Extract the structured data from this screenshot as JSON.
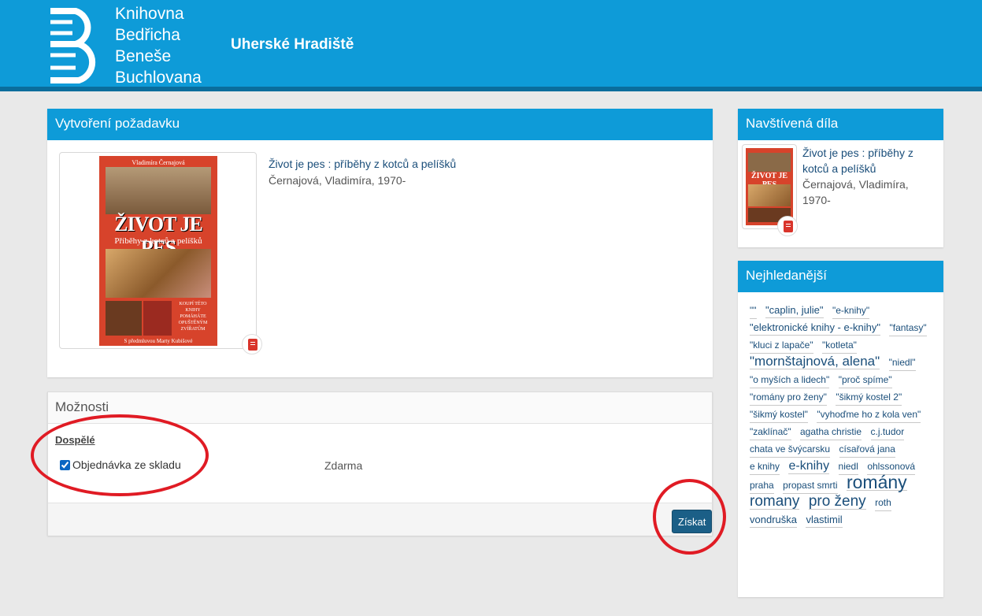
{
  "header": {
    "logo_lines": [
      "Knihovna",
      "Bedřicha",
      "Beneše",
      "Buchlovana"
    ],
    "city": "Uherské Hradiště"
  },
  "request": {
    "heading": "Vytvoření požadavku",
    "book_title": "Život je pes : příběhy z kotců a pelíšků",
    "book_author": "Černajová, Vladimíra, 1970-",
    "cover": {
      "author": "Vladimíra Černajová",
      "title": "ŽIVOT JE PES",
      "subtitle": "Příběhy z kotců a pelíšků",
      "box_text": "KOUPÍ TÉTO KNIHY POMÁHÁTE OPUŠTĚNÝM ZVÍŘATŮM",
      "footer": "S předmluvou Marty Kubišové"
    },
    "format_icon": "book-icon"
  },
  "options": {
    "heading": "Možnosti",
    "group": "Dospělé",
    "checkbox_label": "Objednávka ze skladu",
    "checkbox_checked": true,
    "price": "Zdarma",
    "submit_label": "Získat"
  },
  "visited": {
    "heading": "Navštívená díla",
    "title": "Život je pes : příběhy z kotců a pelíšků",
    "author": "Černajová, Vladimíra, 1970-"
  },
  "popular": {
    "heading": "Nejhledanější",
    "tags": [
      {
        "text": "\"\"",
        "size": 1
      },
      {
        "text": "\"caplin, julie\"",
        "size": 2
      },
      {
        "text": "\"e-knihy\"",
        "size": 1
      },
      {
        "text": "\"elektronické knihy - e-knihy\"",
        "size": 2
      },
      {
        "text": "\"fantasy\"",
        "size": 1
      },
      {
        "text": "\"kluci z lapače\"",
        "size": 1
      },
      {
        "text": "\"kotleta\"",
        "size": 1
      },
      {
        "text": "\"mornštajnová, alena\"",
        "size": 4
      },
      {
        "text": "\"niedl\"",
        "size": 1
      },
      {
        "text": "\"o myších a lidech\"",
        "size": 1
      },
      {
        "text": "\"proč spíme\"",
        "size": 1
      },
      {
        "text": "\"romány pro ženy\"",
        "size": 1
      },
      {
        "text": "\"šikmý kostel 2\"",
        "size": 1
      },
      {
        "text": "\"šikmý kostel\"",
        "size": 1
      },
      {
        "text": "\"vyhoďme ho z kola ven\"",
        "size": 1
      },
      {
        "text": "\"zaklínač\"",
        "size": 1
      },
      {
        "text": "agatha christie",
        "size": 1
      },
      {
        "text": "c.j.tudor",
        "size": 1
      },
      {
        "text": "chata ve švýcarsku",
        "size": 1
      },
      {
        "text": "císařová jana",
        "size": 1
      },
      {
        "text": "e knihy",
        "size": 1
      },
      {
        "text": "e-knihy",
        "size": 3
      },
      {
        "text": "niedl",
        "size": 1
      },
      {
        "text": "ohlssonová",
        "size": 1
      },
      {
        "text": "praha",
        "size": 1
      },
      {
        "text": "propast smrti",
        "size": 1
      },
      {
        "text": "romány",
        "size": 6
      },
      {
        "text": "romany",
        "size": 5
      },
      {
        "text": "pro ženy",
        "size": 5
      },
      {
        "text": "roth",
        "size": 1
      },
      {
        "text": "vondruška",
        "size": 2
      },
      {
        "text": "vlastimil",
        "size": 2
      }
    ]
  },
  "colors": {
    "brand_blue": "#0e9bd8",
    "header_border": "#0a6d9c",
    "link": "#1a4e7a",
    "button": "#1b5f87",
    "annotation_red": "#e01b24"
  }
}
